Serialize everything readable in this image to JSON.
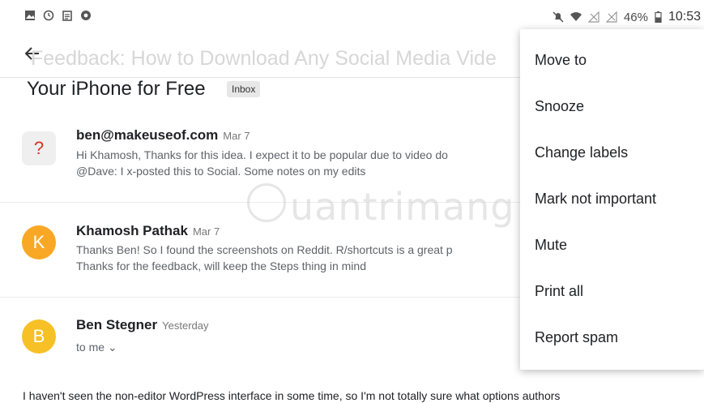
{
  "status_bar": {
    "battery": "46%",
    "time": "10:53"
  },
  "header": {
    "faded_subject": "Feedback: How to Download Any Social Media Vide",
    "subject": "Your iPhone for Free",
    "label_chip": "Inbox"
  },
  "messages": [
    {
      "avatar_letter": "?",
      "sender": "ben@makeuseof.com",
      "date": "Mar 7",
      "line1": "Hi Khamosh, Thanks for this idea. I expect it to be popular due to video do",
      "line2": "@Dave: I x-posted this to Social. Some notes on my edits"
    },
    {
      "avatar_letter": "K",
      "avatar_color": "#f9a825",
      "sender": "Khamosh Pathak",
      "date": "Mar 7",
      "line1": "Thanks Ben! So I found the screenshots on Reddit. R/shortcuts is a great p",
      "line2": "Thanks for the feedback, will keep the Steps thing in mind"
    },
    {
      "avatar_letter": "B",
      "avatar_color": "#f6c026",
      "sender": "Ben Stegner",
      "date": "Yesterday",
      "recipient": "to me"
    }
  ],
  "body_text": "I haven't seen the non-editor WordPress interface in some time, so I'm not totally sure what options authors",
  "watermark": "uantrimang",
  "menu": {
    "items": [
      "Move to",
      "Snooze",
      "Change labels",
      "Mark not important",
      "Mute",
      "Print all",
      "Report spam"
    ]
  },
  "colors": {
    "accent_k": "#f9a825",
    "accent_b": "#f6c026",
    "unknown_icon": "#d93025"
  }
}
